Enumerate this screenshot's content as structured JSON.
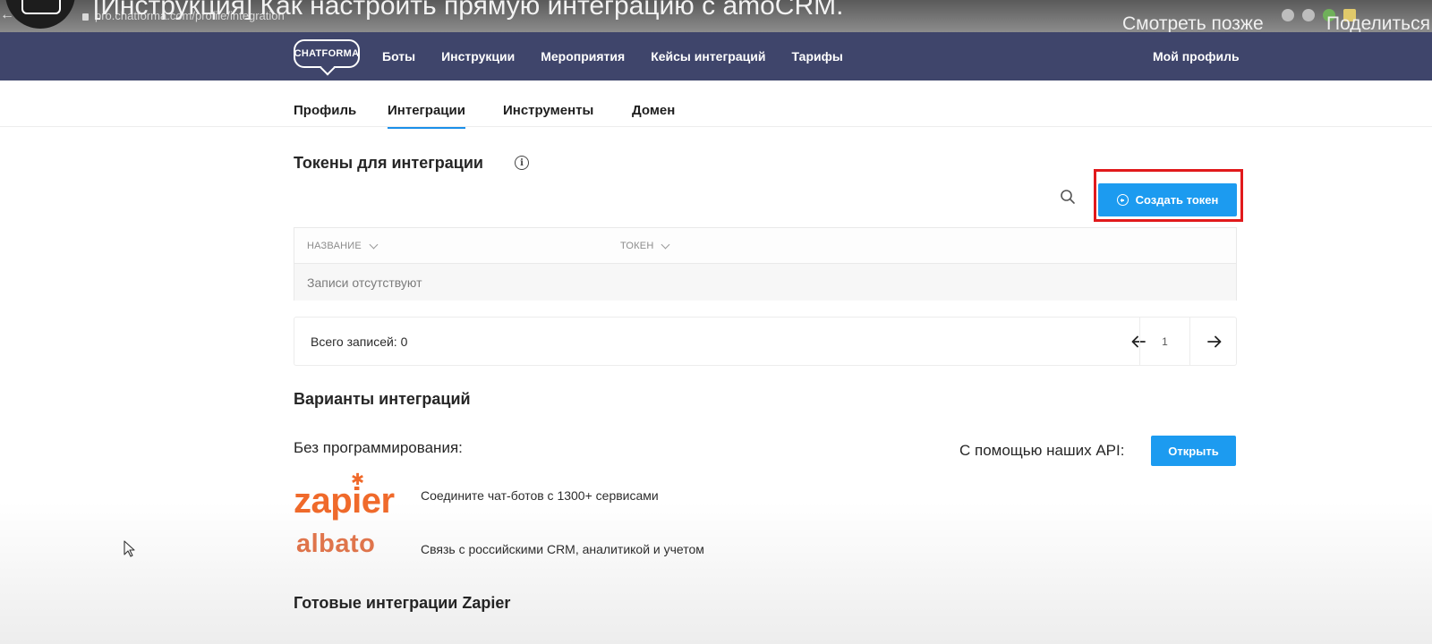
{
  "video": {
    "title": "[Инструкция] Как настроить прямую интеграцию с amoCRM.",
    "watch_later": "Смотреть позже",
    "share": "Поделиться"
  },
  "browser": {
    "url": "pro.chatforma.com/profile/integration"
  },
  "navbar": {
    "logo_text": "CHATFORMA",
    "links": [
      "Боты",
      "Инструкции",
      "Мероприятия",
      "Кейсы интеграций",
      "Тарифы"
    ],
    "profile": "Мой профиль"
  },
  "subtabs": {
    "items": [
      "Профиль",
      "Интеграции",
      "Инструменты",
      "Домен"
    ],
    "active": "Интеграции"
  },
  "tokens": {
    "title": "Токены для интеграции",
    "create_button": "Создать токен",
    "columns": [
      "НАЗВАНИЕ",
      "ТОКЕН"
    ],
    "empty_text": "Записи отсутствуют",
    "total_label": "Всего записей: 0",
    "current_page": "1"
  },
  "variants": {
    "title": "Варианты интеграций",
    "no_code_label": "Без программирования:",
    "api_label": "С помощью наших API:",
    "open_button": "Открыть",
    "services": [
      {
        "name": "zapier",
        "description": "Соедините чат-ботов с 1300+ сервисами",
        "color": "#f06a2b"
      },
      {
        "name": "albato",
        "description": "Связь с российскими CRM, аналитикой и учетом",
        "color": "#e4774d"
      }
    ]
  },
  "ready_zapier_title": "Готовые интеграции Zapier",
  "colors": {
    "navbar": "#3f456b",
    "accent": "#1c9bf0",
    "highlight": "#e1191b",
    "tab_underline": "#1b8fe9"
  }
}
